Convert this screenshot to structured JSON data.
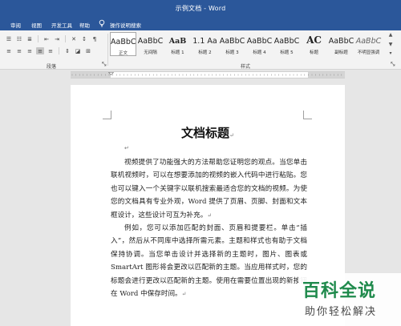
{
  "window": {
    "title": "示例文档 - Word"
  },
  "tabs": [
    {
      "label": "审阅"
    },
    {
      "label": "视图"
    },
    {
      "label": "开发工具"
    },
    {
      "label": "帮助"
    },
    {
      "label": "操作说明搜索"
    }
  ],
  "ribbon": {
    "groups": {
      "paragraph": "段落",
      "styles": "样式"
    },
    "style_gallery": [
      {
        "sample": "AaBbC",
        "name": "正文"
      },
      {
        "sample": "AaBbC",
        "name": "无间隔"
      },
      {
        "sample": "AaB",
        "name": "标题 1"
      },
      {
        "sample": "1.1 Aa",
        "name": "标题 2"
      },
      {
        "sample": "AaBbC",
        "name": "标题 3"
      },
      {
        "sample": "AaBbC",
        "name": "标题 4"
      },
      {
        "sample": "AaBbC",
        "name": "标题 5"
      },
      {
        "sample": "AC",
        "name": "标题"
      },
      {
        "sample": "AaBbC",
        "name": "副标题"
      },
      {
        "sample": "AaBbC",
        "name": "不明显强调"
      }
    ]
  },
  "document": {
    "title": "文档标题",
    "paragraphs": [
      "视频提供了功能强大的方法帮助您证明您的观点。当您单击联机视频时，可以在想要添加的视频的嵌入代码中进行粘贴。您也可以键入一个关键字以联机搜索最适合您的文档的视频。为使您的文档具有专业外观，Word 提供了页眉、页脚、封面和文本框设计，这些设计可互为补充。",
      "例如，您可以添加匹配的封面、页眉和提要栏。单击“插入”，然后从不同库中选择所需元素。主题和样式也有助于文档保持协调。当您单击设计并选择新的主题时，图片、图表或 SmartArt 图形将会更改以匹配新的主题。当应用样式时，您的标题会进行更改以匹配新的主题。使用在需要位置出现的新按钮在 Word 中保存时间。"
    ]
  },
  "watermark": {
    "main": "百科全说",
    "sub": "助你轻松解决"
  },
  "colors": {
    "titlebar": "#2b579a",
    "ribbon": "#f3f3f3",
    "canvas": "#e6e6e6",
    "watermark_green": "#1f8a4c"
  }
}
